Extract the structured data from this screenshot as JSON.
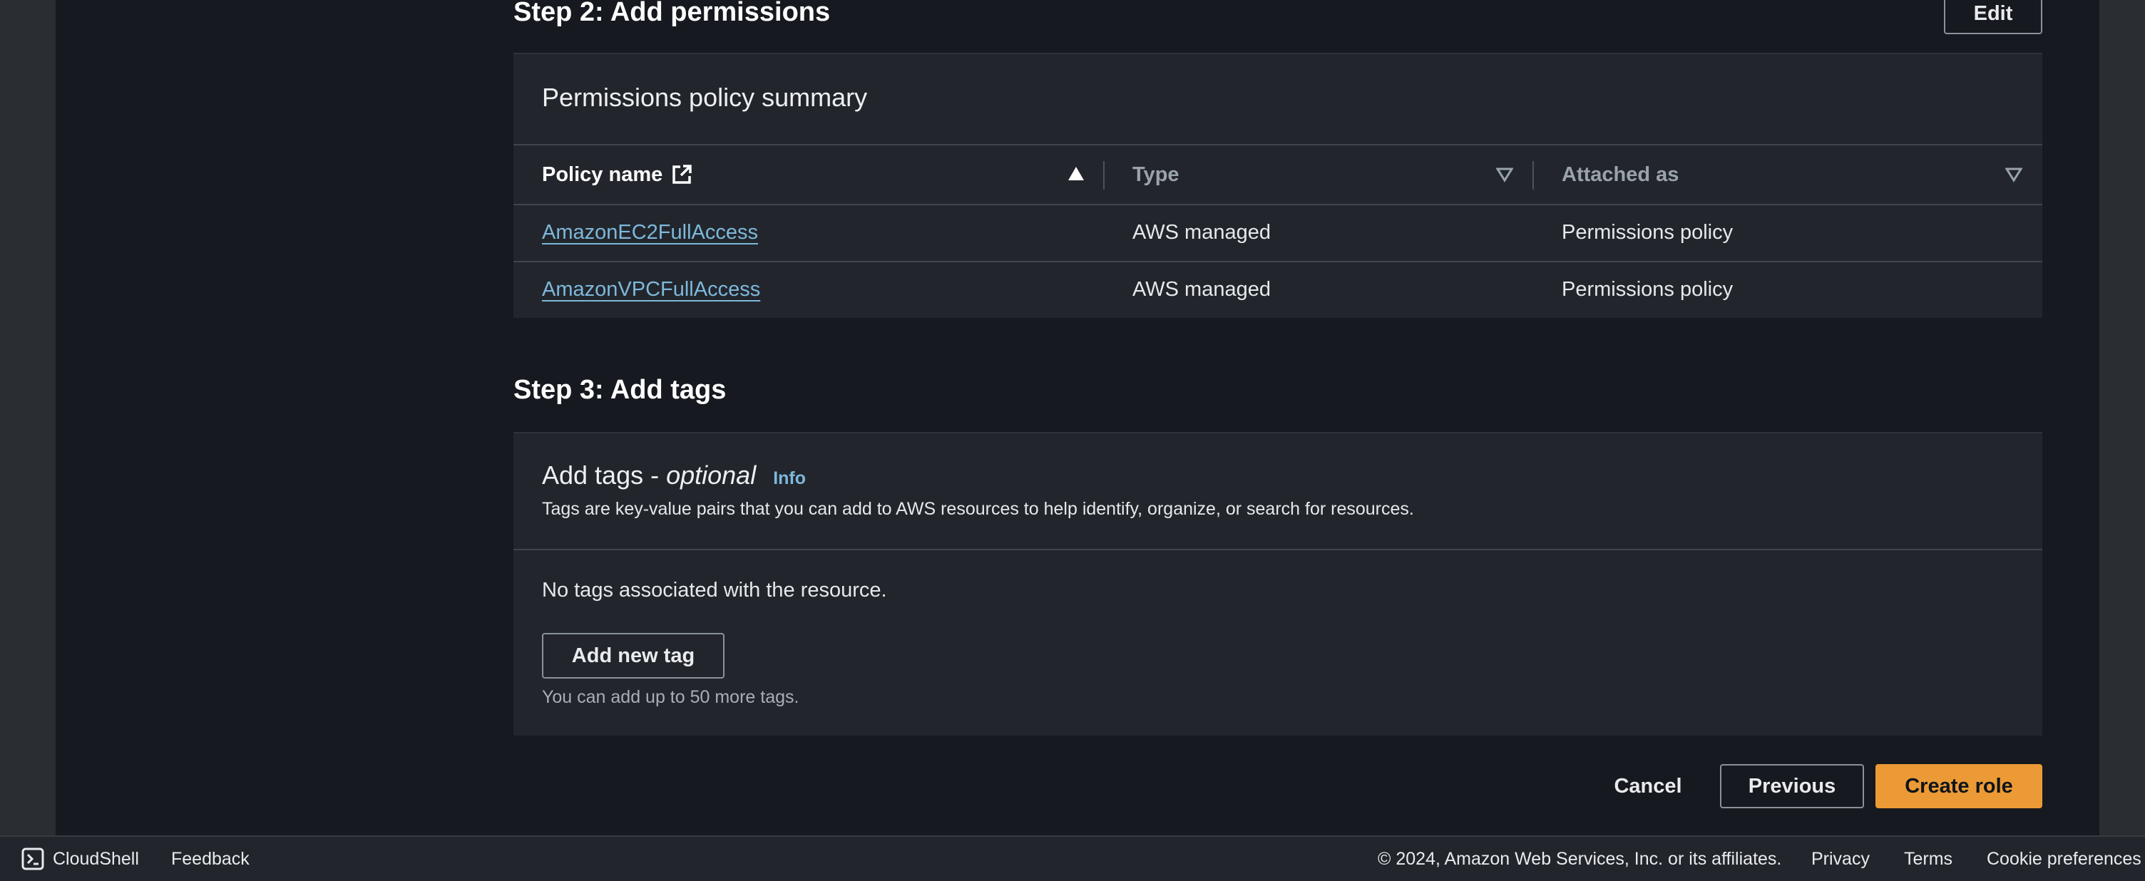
{
  "step2": {
    "title": "Step 2: Add permissions",
    "edit_label": "Edit",
    "panel_title": "Permissions policy summary",
    "columns": [
      "Policy name",
      "Type",
      "Attached as"
    ],
    "rows": [
      {
        "policy": "AmazonEC2FullAccess",
        "type": "AWS managed",
        "attached": "Permissions policy"
      },
      {
        "policy": "AmazonVPCFullAccess",
        "type": "AWS managed",
        "attached": "Permissions policy"
      }
    ]
  },
  "step3": {
    "title": "Step 3: Add tags",
    "panel_title_prefix": "Add tags - ",
    "panel_title_italic": "optional",
    "info_label": "Info",
    "description": "Tags are key-value pairs that you can add to AWS resources to help identify, organize, or search for resources.",
    "empty_text": "No tags associated with the resource.",
    "add_tag_label": "Add new tag",
    "limit_text": "You can add up to 50 more tags."
  },
  "actions": {
    "cancel_label": "Cancel",
    "previous_label": "Previous",
    "create_label": "Create role"
  },
  "footer": {
    "cloudshell_label": "CloudShell",
    "feedback_label": "Feedback",
    "copyright": "© 2024, Amazon Web Services, Inc. or its affiliates.",
    "privacy_label": "Privacy",
    "terms_label": "Terms",
    "cookie_label": "Cookie preferences"
  },
  "colors": {
    "link": "#7eb8dc",
    "primary_button": "#ec9a35",
    "background": "#16191f",
    "panel": "#22262c"
  },
  "icons": [
    "external-link-icon",
    "sort-ascending-icon",
    "sort-dropdown-icon",
    "cloudshell-icon"
  ]
}
